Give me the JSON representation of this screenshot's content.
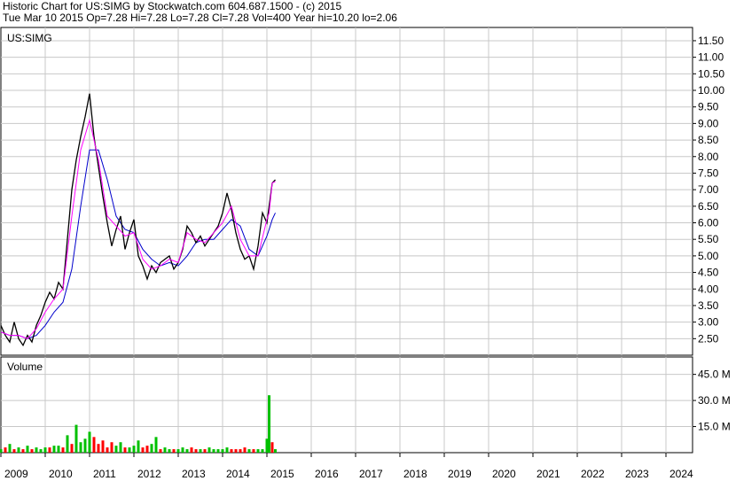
{
  "header": {
    "line1": "Historic Chart for US:SIMG by Stockwatch.com 604.687.1500 - (c) 2015",
    "line2": "Tue Mar 10 2015  Op=7.28  Hi=7.28  Lo=7.28  Cl=7.28  Vol=400  Year hi=10.20  lo=2.06"
  },
  "chart_data": [
    {
      "type": "line",
      "title": "US:SIMG",
      "x_unit": "year",
      "xlim": [
        2009.0,
        2024.6
      ],
      "ylim": [
        2.0,
        11.9
      ],
      "yticks": [
        "2.50",
        "3.00",
        "3.50",
        "4.00",
        "4.50",
        "5.00",
        "5.50",
        "6.00",
        "6.50",
        "7.00",
        "7.50",
        "8.00",
        "8.50",
        "9.00",
        "9.50",
        "10.00",
        "10.50",
        "11.00",
        "11.50"
      ],
      "grid": true,
      "colors": {
        "price": "#000000",
        "ma_short": "#ff00ff",
        "ma_long": "#0000cc"
      },
      "series": [
        {
          "role": "price",
          "x": [
            2009.0,
            2009.1,
            2009.2,
            2009.3,
            2009.4,
            2009.5,
            2009.6,
            2009.7,
            2009.8,
            2009.9,
            2010.0,
            2010.1,
            2010.2,
            2010.3,
            2010.4,
            2010.5,
            2010.6,
            2010.7,
            2010.8,
            2010.9,
            2011.0,
            2011.1,
            2011.2,
            2011.3,
            2011.4,
            2011.5,
            2011.6,
            2011.7,
            2011.8,
            2011.9,
            2012.0,
            2012.1,
            2012.2,
            2012.3,
            2012.4,
            2012.5,
            2012.6,
            2012.7,
            2012.8,
            2012.9,
            2013.0,
            2013.1,
            2013.2,
            2013.3,
            2013.4,
            2013.5,
            2013.6,
            2013.7,
            2013.8,
            2013.9,
            2014.0,
            2014.1,
            2014.2,
            2014.3,
            2014.4,
            2014.5,
            2014.6,
            2014.7,
            2014.8,
            2014.9,
            2015.0,
            2015.05,
            2015.12,
            2015.19
          ],
          "y": [
            2.9,
            2.6,
            2.4,
            3.0,
            2.5,
            2.3,
            2.6,
            2.4,
            2.9,
            3.2,
            3.6,
            3.9,
            3.7,
            4.2,
            4.0,
            5.5,
            7.0,
            7.9,
            8.6,
            9.2,
            9.9,
            8.6,
            7.7,
            6.8,
            6.0,
            5.3,
            5.8,
            6.2,
            5.2,
            5.7,
            6.1,
            5.0,
            4.7,
            4.3,
            4.7,
            4.5,
            4.8,
            4.9,
            5.0,
            4.6,
            4.8,
            5.2,
            5.9,
            5.7,
            5.4,
            5.6,
            5.3,
            5.5,
            5.7,
            5.9,
            6.3,
            6.9,
            6.4,
            5.7,
            5.2,
            4.9,
            5.0,
            4.6,
            5.3,
            6.3,
            6.0,
            6.5,
            7.2,
            7.3
          ]
        },
        {
          "role": "ma_short",
          "x": [
            2009.0,
            2009.2,
            2009.4,
            2009.6,
            2009.8,
            2010.0,
            2010.2,
            2010.4,
            2010.6,
            2010.8,
            2011.0,
            2011.2,
            2011.4,
            2011.6,
            2011.8,
            2012.0,
            2012.2,
            2012.4,
            2012.6,
            2012.8,
            2013.0,
            2013.2,
            2013.4,
            2013.6,
            2013.8,
            2014.0,
            2014.2,
            2014.4,
            2014.6,
            2014.8,
            2015.0,
            2015.05,
            2015.12,
            2015.19
          ],
          "y": [
            2.7,
            2.6,
            2.6,
            2.5,
            2.8,
            3.3,
            3.7,
            4.0,
            6.2,
            8.2,
            9.1,
            7.9,
            6.2,
            5.9,
            5.6,
            5.7,
            4.9,
            4.6,
            4.7,
            4.9,
            4.8,
            5.7,
            5.5,
            5.4,
            5.7,
            6.0,
            6.5,
            5.5,
            5.0,
            5.0,
            6.1,
            6.3,
            7.2,
            7.25
          ]
        },
        {
          "role": "ma_long",
          "x": [
            2009.0,
            2009.2,
            2009.4,
            2009.6,
            2009.8,
            2010.0,
            2010.2,
            2010.4,
            2010.6,
            2010.8,
            2011.0,
            2011.2,
            2011.4,
            2011.6,
            2011.8,
            2012.0,
            2012.2,
            2012.4,
            2012.6,
            2012.8,
            2013.0,
            2013.2,
            2013.4,
            2013.6,
            2013.8,
            2014.0,
            2014.2,
            2014.4,
            2014.6,
            2014.8,
            2015.0,
            2015.05,
            2015.12,
            2015.19
          ],
          "y": [
            2.7,
            2.6,
            2.6,
            2.5,
            2.6,
            2.9,
            3.3,
            3.6,
            4.6,
            6.5,
            8.2,
            8.2,
            7.3,
            6.2,
            5.8,
            5.7,
            5.2,
            4.9,
            4.7,
            4.8,
            4.7,
            5.0,
            5.4,
            5.5,
            5.5,
            5.8,
            6.1,
            5.9,
            5.2,
            5.0,
            5.6,
            5.8,
            6.1,
            6.3
          ]
        }
      ]
    },
    {
      "type": "bar",
      "title": "Volume",
      "xlim": [
        2009.0,
        2024.6
      ],
      "ylim": [
        0,
        55
      ],
      "yticks": [
        "15.0 M",
        "30.0 M",
        "45.0 M"
      ],
      "x_ticks": [
        "2009",
        "2010",
        "2011",
        "2012",
        "2013",
        "2014",
        "2015",
        "2016",
        "2017",
        "2018",
        "2019",
        "2020",
        "2021",
        "2022",
        "2023",
        "2024"
      ],
      "grid": true,
      "colors": {
        "up": "#00c000",
        "down": "#ff0000"
      },
      "x": [
        2009.0,
        2009.1,
        2009.2,
        2009.3,
        2009.4,
        2009.5,
        2009.6,
        2009.7,
        2009.8,
        2009.9,
        2010.0,
        2010.1,
        2010.2,
        2010.3,
        2010.4,
        2010.5,
        2010.6,
        2010.7,
        2010.8,
        2010.9,
        2011.0,
        2011.1,
        2011.2,
        2011.3,
        2011.4,
        2011.5,
        2011.6,
        2011.7,
        2011.8,
        2011.9,
        2012.0,
        2012.1,
        2012.2,
        2012.3,
        2012.4,
        2012.5,
        2012.6,
        2012.7,
        2012.8,
        2012.9,
        2013.0,
        2013.1,
        2013.2,
        2013.3,
        2013.4,
        2013.5,
        2013.6,
        2013.7,
        2013.8,
        2013.9,
        2014.0,
        2014.1,
        2014.2,
        2014.3,
        2014.4,
        2014.5,
        2014.6,
        2014.7,
        2014.8,
        2014.9,
        2015.0,
        2015.05,
        2015.12,
        2015.19
      ],
      "values": [
        2,
        3,
        5,
        2,
        3,
        2,
        4,
        2,
        3,
        2,
        3,
        3,
        4,
        4,
        3,
        10,
        5,
        16,
        6,
        8,
        12,
        9,
        5,
        7,
        3,
        6,
        4,
        6,
        3,
        3,
        4,
        7,
        3,
        4,
        5,
        9,
        2,
        3,
        2,
        2,
        2,
        3,
        2,
        3,
        2,
        2,
        2,
        3,
        2,
        2,
        2,
        3,
        2,
        2,
        2,
        3,
        2,
        2,
        2,
        2,
        8,
        33,
        6,
        2
      ],
      "up": [
        1,
        0,
        1,
        0,
        1,
        0,
        1,
        0,
        1,
        1,
        1,
        0,
        1,
        1,
        0,
        1,
        0,
        1,
        1,
        1,
        1,
        0,
        0,
        0,
        0,
        0,
        1,
        1,
        0,
        1,
        1,
        1,
        0,
        0,
        1,
        1,
        0,
        1,
        1,
        0,
        1,
        1,
        1,
        0,
        0,
        1,
        0,
        1,
        1,
        1,
        1,
        1,
        0,
        0,
        0,
        0,
        1,
        0,
        1,
        1,
        1,
        1,
        0,
        1
      ]
    }
  ]
}
